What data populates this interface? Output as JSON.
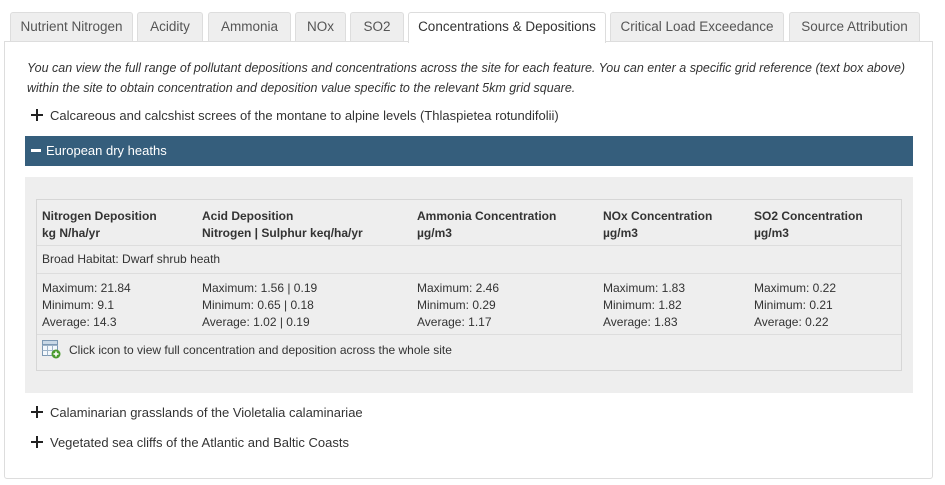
{
  "tabs": [
    {
      "label": "Nutrient Nitrogen",
      "active": false
    },
    {
      "label": "Acidity",
      "active": false
    },
    {
      "label": "Ammonia",
      "active": false
    },
    {
      "label": "NOx",
      "active": false
    },
    {
      "label": "SO2",
      "active": false
    },
    {
      "label": "Concentrations & Depositions",
      "active": true
    },
    {
      "label": "Critical Load Exceedance",
      "active": false
    },
    {
      "label": "Source Attribution",
      "active": false
    }
  ],
  "intro_text": "You can view the full range of pollutant depositions and concentrations across the site for each feature. You can enter a specific grid reference (text box above) within the site to obtain concentration and deposition value specific to the relevant 5km grid square.",
  "features": [
    {
      "label": "Calcareous and calcshist screes of the montane to alpine levels (Thlaspietea rotundifolii)",
      "expanded": false
    },
    {
      "label": "European dry heaths",
      "expanded": true
    },
    {
      "label": "Calaminarian grasslands of the Violetalia calaminariae",
      "expanded": false
    },
    {
      "label": "Vegetated sea cliffs of the Atlantic and Baltic Coasts",
      "expanded": false
    }
  ],
  "table": {
    "columns": [
      {
        "title": "Nitrogen Deposition",
        "unit": "kg N/ha/yr",
        "maximum": "Maximum: 21.84",
        "minimum": "Minimum: 9.1",
        "average": "Average: 14.3"
      },
      {
        "title": "Acid Deposition",
        "unit": "Nitrogen | Sulphur keq/ha/yr",
        "maximum": "Maximum: 1.56 | 0.19",
        "minimum": "Minimum: 0.65 | 0.18",
        "average": "Average: 1.02 | 0.19"
      },
      {
        "title": "Ammonia Concentration",
        "unit": "µg/m3",
        "maximum": "Maximum: 2.46",
        "minimum": "Minimum: 0.29",
        "average": "Average: 1.17"
      },
      {
        "title": "NOx Concentration",
        "unit": "µg/m3",
        "maximum": "Maximum: 1.83",
        "minimum": "Minimum: 1.82",
        "average": "Average: 1.83"
      },
      {
        "title": "SO2 Concentration",
        "unit": "µg/m3",
        "maximum": "Maximum: 0.22",
        "minimum": "Minimum: 0.21",
        "average": "Average: 0.22"
      }
    ],
    "habitat": "Broad Habitat: Dwarf shrub heath",
    "link_text": "Click icon to view full concentration and deposition across the whole site"
  },
  "colors": {
    "accent_bar": "#355e7c",
    "tab_bg": "#eeeeee",
    "panel_gray": "#eeeeee",
    "icon_plus": "#4a9a2e"
  },
  "icons": {
    "expand": "plus-icon",
    "collapse": "minus-icon",
    "grid": "grid-add-icon"
  }
}
